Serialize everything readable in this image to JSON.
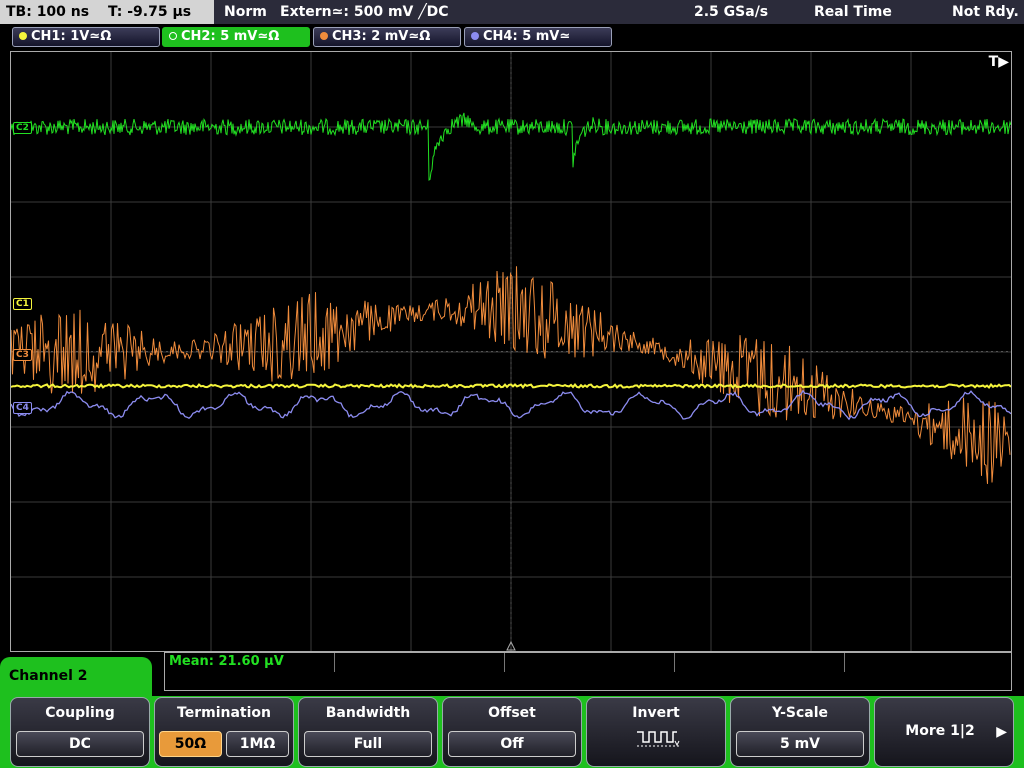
{
  "topbar": {
    "timebase": "TB: 100 ns",
    "trigger_time": "T: -9.75 µs",
    "mode": "Norm",
    "trigger": "Extern≃: 500 mV ╱DC",
    "sample_rate": "2.5 GSa/s",
    "acq_mode": "Real Time",
    "status": "Not Rdy."
  },
  "channels": [
    {
      "label": "CH1: 1V≃Ω",
      "color": "#f5f53c"
    },
    {
      "label": "CH2: 5 mV≃Ω",
      "color": "#22e022"
    },
    {
      "label": "CH3: 2 mV≃Ω",
      "color": "#f08c3c"
    },
    {
      "label": "CH4: 5 mV≃",
      "color": "#8c8cf0"
    }
  ],
  "screen": {
    "trigger_marker": "T▶",
    "markers": [
      "C2",
      "C1",
      "C3",
      "C4"
    ],
    "measurement": "Mean: 21.60 µV"
  },
  "menu": {
    "title": "Channel 2",
    "coupling": {
      "label": "Coupling",
      "value": "DC"
    },
    "termination": {
      "label": "Termination",
      "options": [
        "50Ω",
        "1MΩ"
      ],
      "selected": "50Ω"
    },
    "bandwidth": {
      "label": "Bandwidth",
      "value": "Full"
    },
    "offset": {
      "label": "Offset",
      "value": "Off"
    },
    "invert": {
      "label": "Invert",
      "icon": "inverted-square-wave-icon"
    },
    "yscale": {
      "label": "Y-Scale",
      "value": "5 mV"
    },
    "more": {
      "label": "More 1|2"
    }
  },
  "colors": {
    "grid": "#3a3a3a",
    "menu_accent": "#1ec01e"
  }
}
